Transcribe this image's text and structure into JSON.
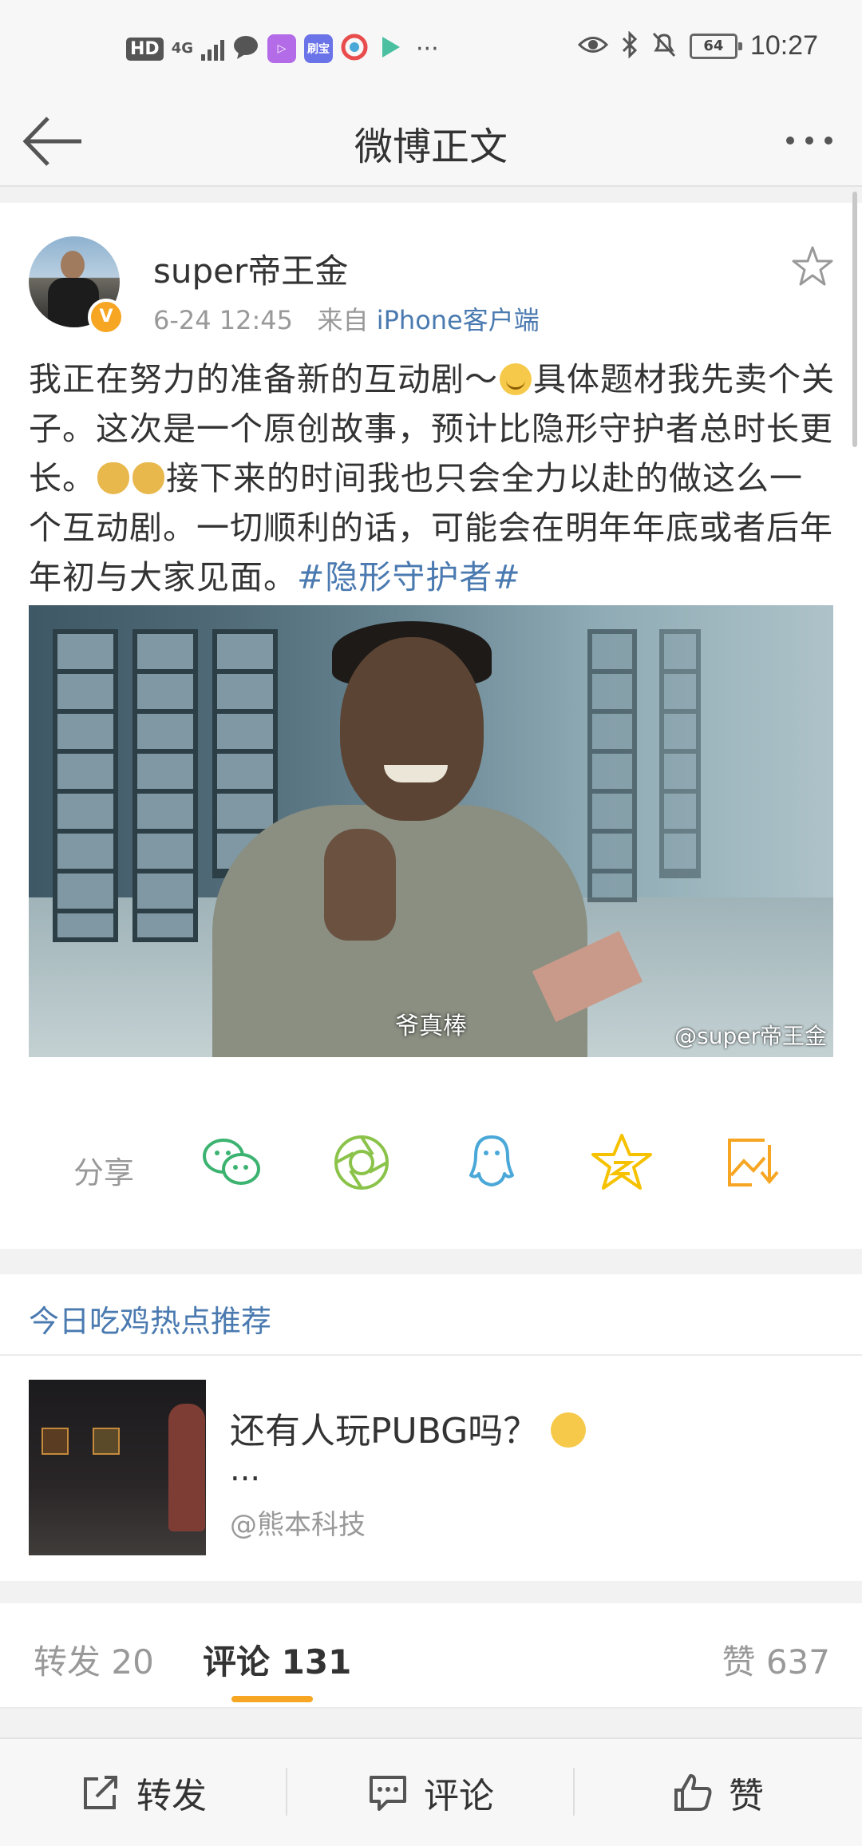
{
  "status_bar": {
    "left_hd": "HD",
    "left_net": "4G",
    "left_apps": [
      "message-icon",
      "video-icon",
      "刷宝",
      "browser-icon",
      "play-icon"
    ],
    "app_badge": "刷宝",
    "more": "···",
    "battery": "64",
    "time": "10:27"
  },
  "nav": {
    "title": "微博正文",
    "back_icon": "back-arrow-icon",
    "more_icon": "more-dots-icon"
  },
  "post": {
    "username": "super帝王金",
    "verified_badge": "V",
    "time": "6-24 12:45",
    "from_label": "来自",
    "source": "iPhone客户端",
    "text_parts": {
      "p1": "我正在努力的准备新的互动剧～",
      "p2": "具体题材我先卖个关子。这次是一个原创故事，预计比隐形守护者总时长更长。",
      "p3": "接下来的时间我也只会全力以赴的做这么一个互动剧。一切顺利的话，可能会在明年年底或者后年年初与大家见面。",
      "hashtag": "#隐形守护者#"
    },
    "image": {
      "caption": "爷真棒",
      "watermark": "@super帝王金"
    }
  },
  "share": {
    "label": "分享",
    "targets": [
      "wechat-icon",
      "moments-icon",
      "qq-icon",
      "qzone-icon",
      "save-image-icon"
    ]
  },
  "recommend": {
    "section_title": "今日吃鸡热点推荐",
    "headline": "还有人玩PUBG吗？",
    "ellipsis": "...",
    "author": "@熊本科技"
  },
  "tabs": {
    "repost": "转发 20",
    "comment": "评论 131",
    "like": "赞 637"
  },
  "bottom_bar": {
    "repost": "转发",
    "comment": "评论",
    "like": "赞"
  },
  "colors": {
    "link": "#4a7ab0",
    "accent": "#f6a623",
    "wechat": "#3cb371",
    "moments": "#8bc34a",
    "qq": "#4aa8d8",
    "qzone": "#f6c200",
    "save": "#f6a623"
  }
}
